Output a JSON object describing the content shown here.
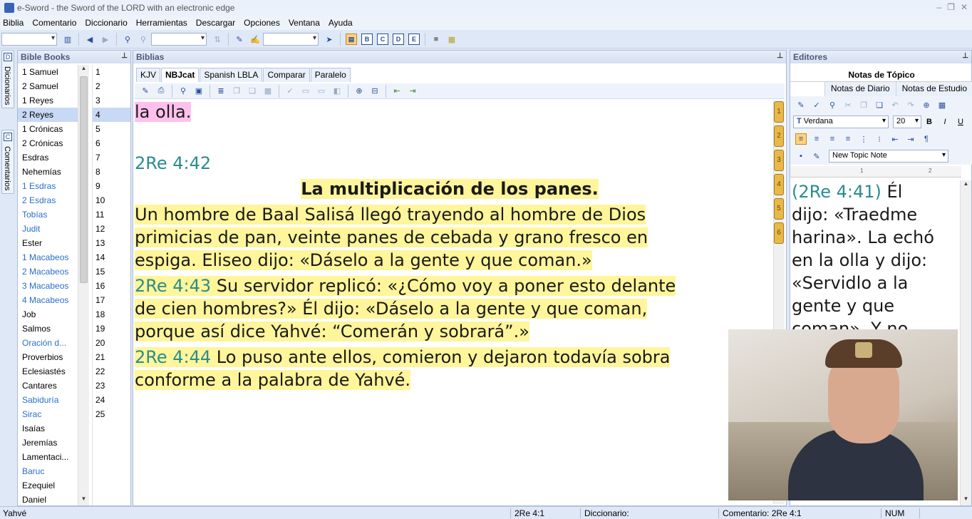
{
  "window": {
    "title": "e-Sword - the Sword of the LORD with an electronic edge",
    "controls": [
      "–",
      "❐",
      "✕"
    ]
  },
  "menu": [
    "Biblia",
    "Comentario",
    "Diccionario",
    "Herramientas",
    "Descargar",
    "Opciones",
    "Ventana",
    "Ayuda"
  ],
  "toolbar": {
    "layout_buttons": [
      "B",
      "C",
      "D",
      "E"
    ]
  },
  "side_tabs": {
    "dictionaries": "Dicionarios",
    "dictionaries_icon_letter": "D",
    "commentaries": "Comentarios",
    "commentaries_icon_letter": "C"
  },
  "books_panel": {
    "title": "Bible Books",
    "books": [
      {
        "name": "1 Samuel",
        "blue": false
      },
      {
        "name": "2 Samuel",
        "blue": false
      },
      {
        "name": "1 Reyes",
        "blue": false
      },
      {
        "name": "2 Reyes",
        "blue": false,
        "selected": true
      },
      {
        "name": "1 Crónicas",
        "blue": false
      },
      {
        "name": "2 Crónicas",
        "blue": false
      },
      {
        "name": "Esdras",
        "blue": false
      },
      {
        "name": "Nehemías",
        "blue": false
      },
      {
        "name": "1 Esdras",
        "blue": true
      },
      {
        "name": "2 Esdras",
        "blue": true
      },
      {
        "name": "Tobías",
        "blue": true
      },
      {
        "name": "Judit",
        "blue": true
      },
      {
        "name": "Ester",
        "blue": false
      },
      {
        "name": "1 Macabeos",
        "blue": true
      },
      {
        "name": "2 Macabeos",
        "blue": true
      },
      {
        "name": "3 Macabeos",
        "blue": true
      },
      {
        "name": "4 Macabeos",
        "blue": true
      },
      {
        "name": "Job",
        "blue": false
      },
      {
        "name": "Salmos",
        "blue": false
      },
      {
        "name": "Oración d...",
        "blue": true
      },
      {
        "name": "Proverbios",
        "blue": false
      },
      {
        "name": "Eclesiastés",
        "blue": false
      },
      {
        "name": "Cantares",
        "blue": false
      },
      {
        "name": "Sabiduría",
        "blue": true
      },
      {
        "name": "Sirac",
        "blue": true
      },
      {
        "name": "Isaías",
        "blue": false
      },
      {
        "name": "Jeremías",
        "blue": false
      },
      {
        "name": "Lamentaci...",
        "blue": false
      },
      {
        "name": "Baruc",
        "blue": true
      },
      {
        "name": "Ezequiel",
        "blue": false
      },
      {
        "name": "Daniel",
        "blue": false
      }
    ],
    "chapters": [
      "1",
      "2",
      "3",
      "4",
      "5",
      "6",
      "7",
      "8",
      "9",
      "10",
      "11",
      "12",
      "13",
      "14",
      "15",
      "16",
      "17",
      "18",
      "19",
      "20",
      "21",
      "22",
      "23",
      "24",
      "25"
    ],
    "selected_chapter": "4"
  },
  "bibles_panel": {
    "title": "Biblias",
    "tabs": [
      "KJV",
      "NBJcat",
      "Spanish LBLA",
      "Comparar",
      "Paralelo"
    ],
    "active_tab": "NBJcat",
    "text": {
      "prev_fragment": "la olla.",
      "ref_42": "2Re 4:42",
      "heading": "La multiplicación de los panes.",
      "verse_42_l1": "Un hombre de Baal Salisá llegó trayendo al hombre de Dios",
      "verse_42_l2": "primicias de pan, veinte panes de cebada y grano fresco en",
      "verse_42_l3": "espiga. Eliseo dijo: «Dáselo a la gente y que coman.»",
      "ref_43": "2Re 4:43",
      "verse_43_l1": " Su servidor replicó: «¿Cómo voy a poner esto delante",
      "verse_43_l2": "de cien hombres?» Él dijo: «Dáselo a la gente y que coman,",
      "verse_43_l3": "porque así dice Yahvé: “Comerán y sobrará”.»",
      "ref_44": "2Re 4:44",
      "verse_44_l1": " Lo puso ante ellos, comieron y dejaron todavía sobra",
      "verse_44_l2": "conforme a la palabra de Yahvé."
    },
    "bookmarks": [
      "1",
      "2",
      "3",
      "4",
      "5",
      "6"
    ]
  },
  "editors_panel": {
    "title": "Editores",
    "topic_title": "Notas de Tópico",
    "subtabs": [
      "Notas de Diario",
      "Notas de Estudio"
    ],
    "font_name": "Verdana",
    "font_size": "20",
    "topic_select": "New Topic Note",
    "ruler_marks": [
      "1",
      "2"
    ],
    "note": {
      "ref": "(2Re 4:41)",
      "l1_rest": "  Él",
      "l2": "dijo: «Traedme",
      "l3": "harina». La echó",
      "l4": "en la olla y dijo:",
      "l5": "«Servidlo a la",
      "l6": "gente y que",
      "l7": "coman». Y no"
    }
  },
  "statusbar": {
    "left": "Yahvé",
    "verse": "2Re 4:1",
    "dictionary": "Diccionario:",
    "commentary": "Comentario: 2Re 4:1",
    "num": "NUM"
  },
  "colors": {
    "verse_highlight": "#fff59a",
    "pink_highlight": "#ffc0ee",
    "reference": "#2b8c8c",
    "link_blue": "#2a6fc9"
  }
}
